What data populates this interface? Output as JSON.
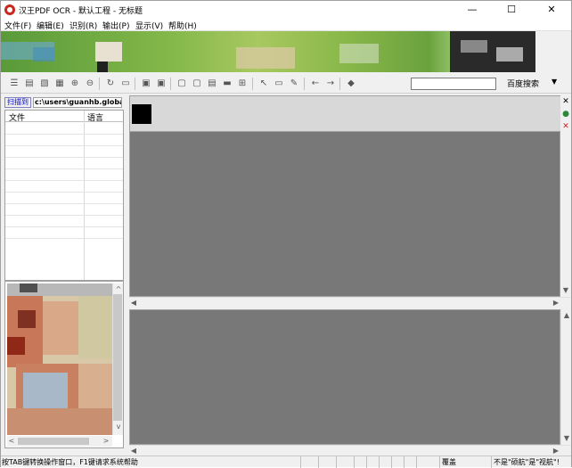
{
  "window": {
    "title": "汉王PDF OCR - 默认工程 - 无标题",
    "minimize": "—",
    "maximize": "☐",
    "close": "✕"
  },
  "menu": [
    "文件(F)",
    "编辑(E)",
    "识别(R)",
    "输出(P)",
    "显示(V)",
    "帮助(H)"
  ],
  "toolbar": {
    "search_value": "",
    "search_button": "百度搜索",
    "dropdown_arrow": "▼"
  },
  "left_panel": {
    "scan_button": "扫描到",
    "scan_path": "c:\\users\\guanhb.globa",
    "columns": [
      "文件",
      "语言"
    ]
  },
  "side_icons": {
    "close_top": "✕",
    "green_icon": "●",
    "red_close": "✕"
  },
  "scroll": {
    "up": "▲",
    "down": "▼",
    "left": "◀",
    "right": "▶",
    "up_small": "^",
    "down_small": "v",
    "left_small": "<",
    "right_small": ">"
  },
  "statusbar": {
    "hint": "按TAB键转换操作窗口，F1键请求系统帮助",
    "mode": "覆盖",
    "nav": "不是\"硕航\"是\"视航\"!"
  },
  "colors": {
    "app_icon": "#c8281e",
    "pane_gray": "#787878",
    "link_blue": "#0000d0"
  }
}
